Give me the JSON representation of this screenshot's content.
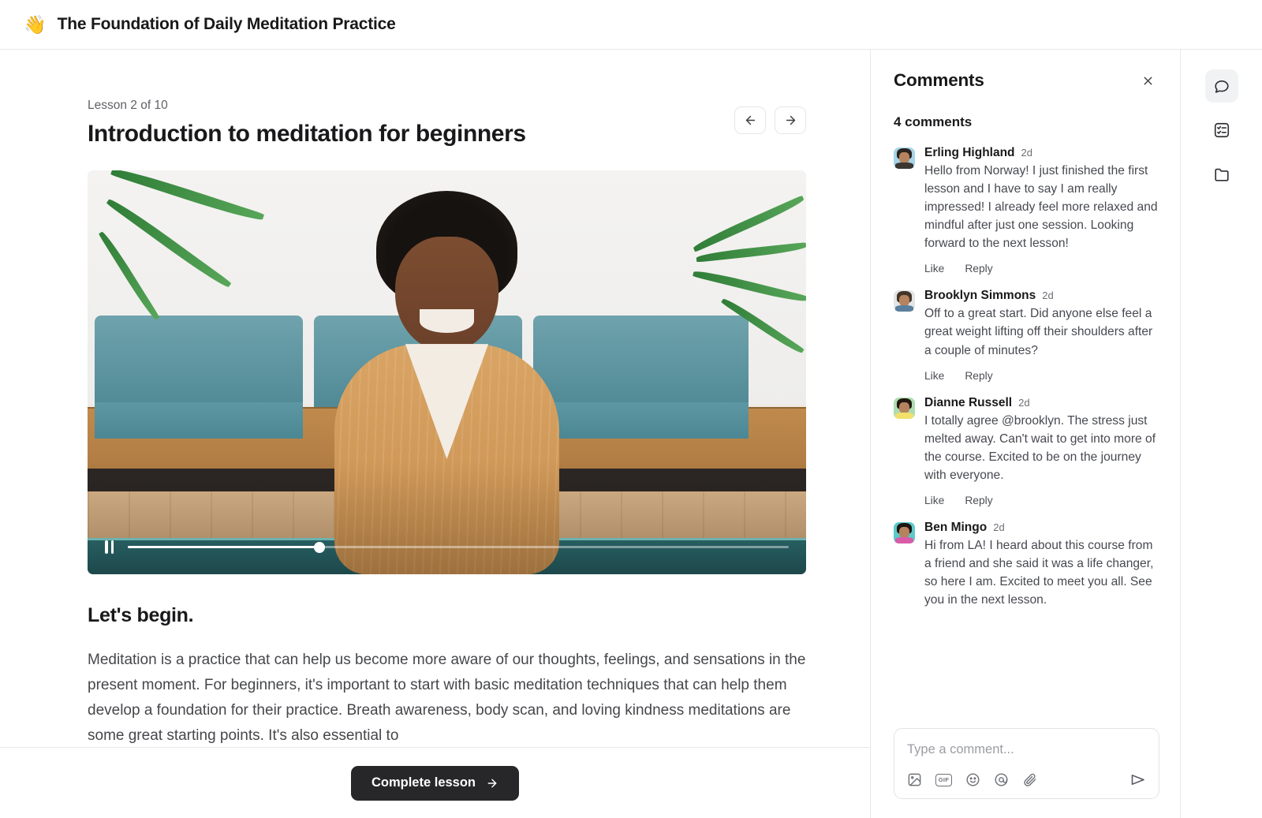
{
  "header": {
    "emoji": "👋",
    "title": "The Foundation of Daily Meditation Practice"
  },
  "lesson": {
    "eyebrow": "Lesson 2 of 10",
    "title": "Introduction to meditation for beginners",
    "prev_label": "Previous lesson",
    "next_label": "Next lesson",
    "video": {
      "state": "playing",
      "progress_percent": 29,
      "pause_label": "Pause"
    },
    "article": {
      "heading": "Let's begin.",
      "paragraph": "Meditation is a practice that can help us become more aware of our thoughts, feelings, and sensations in the present moment. For beginners, it's important to start with basic meditation techniques that can help them develop a foundation for their practice. Breath awareness, body scan, and loving kindness meditations are some great starting points. It's also essential to"
    },
    "complete_button": "Complete lesson"
  },
  "comments": {
    "title": "Comments",
    "close_label": "Close comments",
    "count_label": "4 comments",
    "like_label": "Like",
    "reply_label": "Reply",
    "items": [
      {
        "author": "Erling Highland",
        "time": "2d",
        "text": "Hello from Norway! I just finished the first lesson and I have to say I am really impressed! I already feel more relaxed and mindful after just one session. Looking forward to the next lesson!",
        "avatar_bg": "#a6d4e8",
        "avatar_hair": "#2a2420",
        "avatar_body": "#3b3632"
      },
      {
        "author": "Brooklyn Simmons",
        "time": "2d",
        "text": "Off to a great start. Did anyone else feel a great weight lifting off their shoulders after a couple of minutes?",
        "avatar_bg": "#e3e4e6",
        "avatar_hair": "#43342a",
        "avatar_body": "#5a7f9e"
      },
      {
        "author": "Dianne Russell",
        "time": "2d",
        "text": "I totally agree @brooklyn. The stress just melted away. Can't wait to get into more of the course. Excited to be on the journey with everyone.",
        "avatar_bg": "#aedcb0",
        "avatar_hair": "#22180f",
        "avatar_body": "#f2e06a"
      },
      {
        "author": "Ben Mingo",
        "time": "2d",
        "text": "Hi from LA! I heard about this course from a friend and she said it was a life changer, so here I am. Excited to meet you all. See you in the next lesson.",
        "avatar_bg": "#5ec9c9",
        "avatar_hair": "#1c1512",
        "avatar_body": "#d95ba8"
      }
    ],
    "composer": {
      "placeholder": "Type a comment...",
      "value": "",
      "icons": [
        "image-icon",
        "gif-icon",
        "emoji-icon",
        "mention-icon",
        "attachment-icon"
      ],
      "gif_label": "GIF",
      "send_label": "Send comment"
    }
  },
  "rail": {
    "items": [
      {
        "icon": "chat-bubble-icon",
        "label": "Comments",
        "active": true
      },
      {
        "icon": "checklist-icon",
        "label": "Tasks",
        "active": false
      },
      {
        "icon": "folder-icon",
        "label": "Files",
        "active": false
      }
    ]
  },
  "colors": {
    "accent_dark": "#27272a",
    "border": "#e8e8e8",
    "text_primary": "#19191b",
    "text_secondary": "#46474b"
  }
}
